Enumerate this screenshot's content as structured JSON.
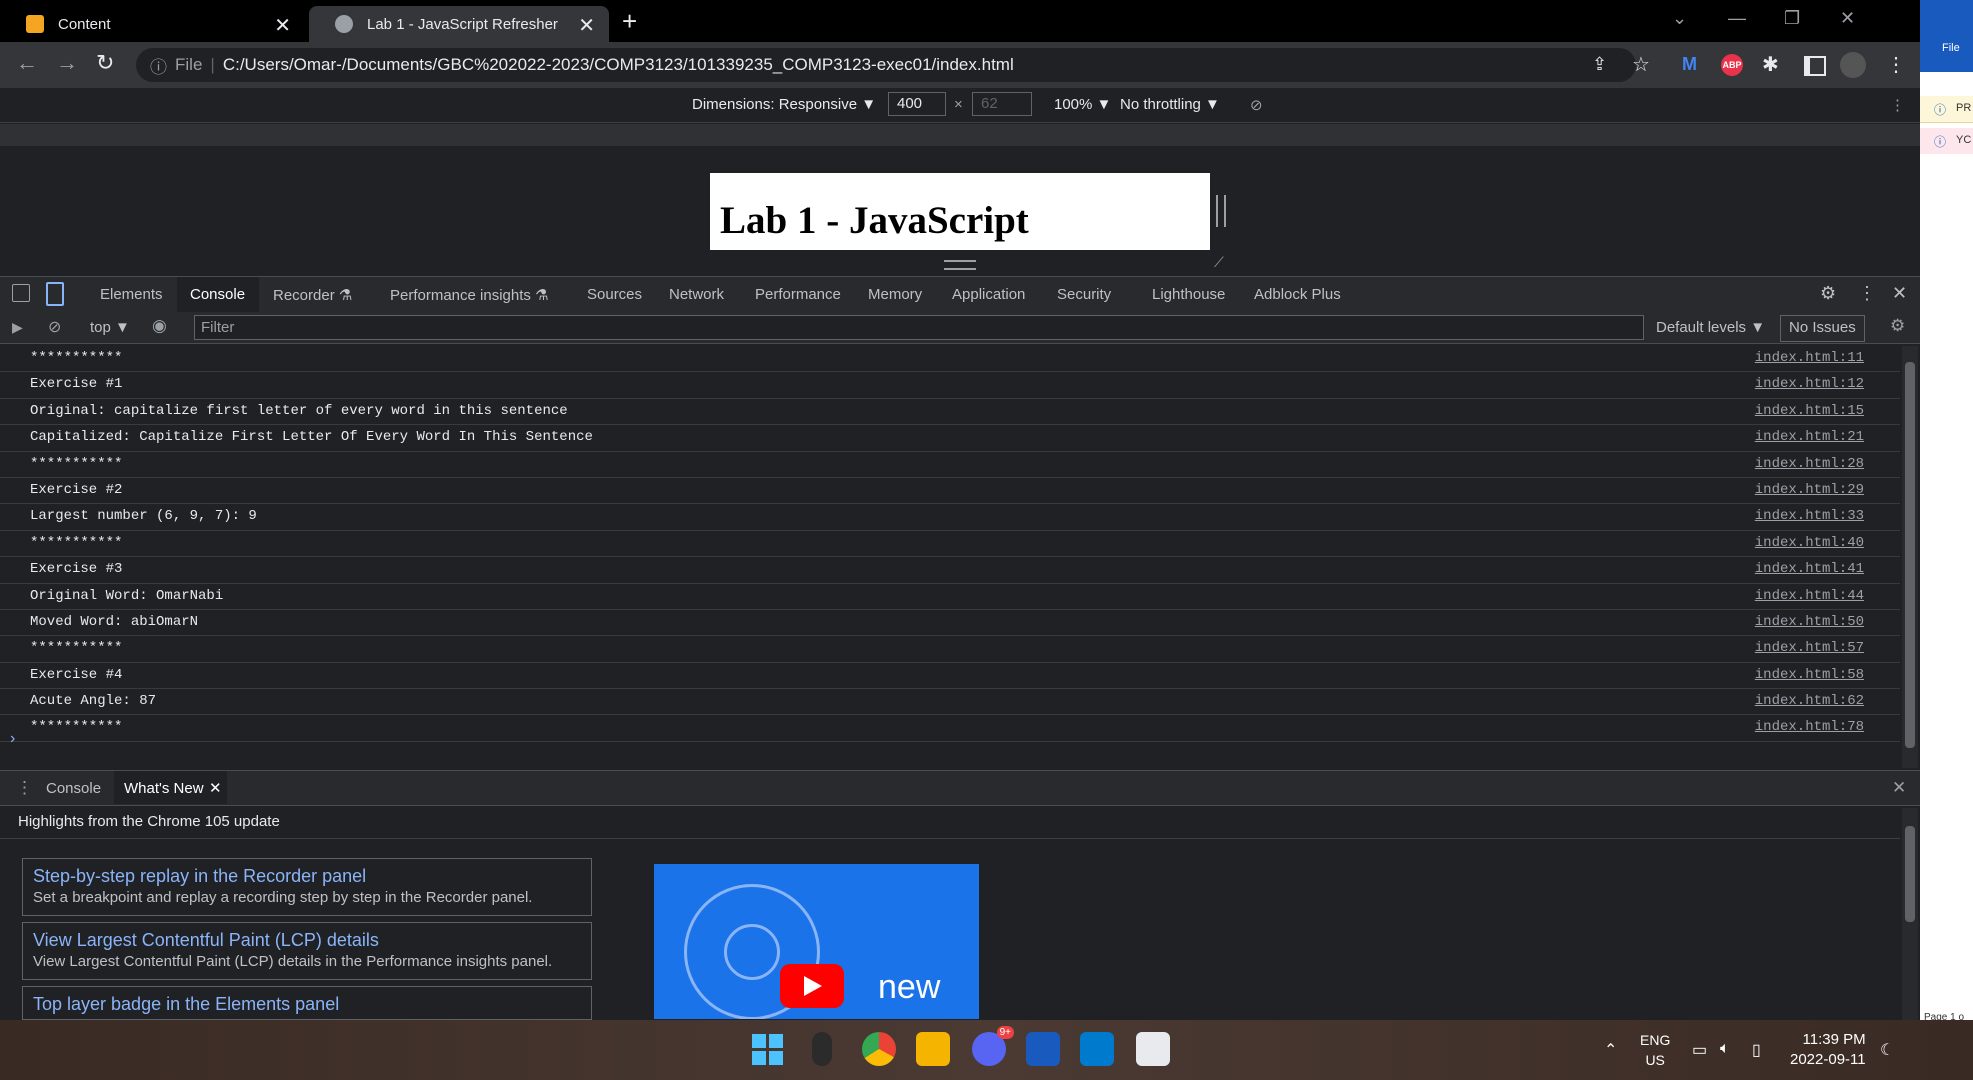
{
  "browser": {
    "tabs": [
      {
        "title": "Content"
      },
      {
        "title": "Lab 1 - JavaScript Refresher"
      }
    ],
    "url_scheme": "File",
    "url": "C:/Users/Omar-/Documents/GBC%202022-2023/COMP3123/101339235_COMP3123-exec01/index.html",
    "extensions": [
      "ABP"
    ]
  },
  "device_toolbar": {
    "dimensions_label": "Dimensions: Responsive ▼",
    "width": "400",
    "height_placeholder": "62",
    "times": "×",
    "zoom": "100% ▼",
    "throttling": "No throttling ▼"
  },
  "page": {
    "heading": "Lab 1 - JavaScript"
  },
  "devtools": {
    "tabs": [
      "Elements",
      "Console",
      "Recorder ⚗",
      "Performance insights ⚗",
      "Sources",
      "Network",
      "Performance",
      "Memory",
      "Application",
      "Security",
      "Lighthouse",
      "Adblock Plus"
    ],
    "active_tab": "Console",
    "console_toolbar": {
      "context": "top ▼",
      "filter_placeholder": "Filter",
      "levels": "Default levels ▼",
      "issues": "No Issues"
    },
    "logs": [
      {
        "msg": "***********",
        "src": "index.html:11"
      },
      {
        "msg": "Exercise #1",
        "src": "index.html:12"
      },
      {
        "msg": "Original: capitalize first letter of every word in this sentence",
        "src": "index.html:15"
      },
      {
        "msg": "Capitalized: Capitalize First Letter Of Every Word In This Sentence",
        "src": "index.html:21"
      },
      {
        "msg": "***********",
        "src": "index.html:28"
      },
      {
        "msg": "Exercise #2",
        "src": "index.html:29"
      },
      {
        "msg": "Largest number (6, 9, 7): 9",
        "src": "index.html:33"
      },
      {
        "msg": "***********",
        "src": "index.html:40"
      },
      {
        "msg": "Exercise #3",
        "src": "index.html:41"
      },
      {
        "msg": "Original Word: OmarNabi",
        "src": "index.html:44"
      },
      {
        "msg": "Moved Word: abiOmarN",
        "src": "index.html:50"
      },
      {
        "msg": "***********",
        "src": "index.html:57"
      },
      {
        "msg": "Exercise #4",
        "src": "index.html:58"
      },
      {
        "msg": "Acute Angle: 87",
        "src": "index.html:62"
      },
      {
        "msg": "***********",
        "src": "index.html:78"
      }
    ],
    "drawer": {
      "tabs": [
        "Console",
        "What's New"
      ],
      "highlights": "Highlights from the Chrome 105 update",
      "cards": [
        {
          "title": "Step-by-step replay in the Recorder panel",
          "desc": "Set a breakpoint and replay a recording step by step in the Recorder panel."
        },
        {
          "title": "View Largest Contentful Paint (LCP) details",
          "desc": "View Largest Contentful Paint (LCP) details in the Performance insights panel."
        },
        {
          "title": "Top layer badge in the Elements panel",
          "desc": ""
        }
      ],
      "video_text": "new"
    }
  },
  "side_app": {
    "file": "File",
    "items": [
      "PR",
      "YC"
    ],
    "page": "Page 1 o"
  },
  "taskbar": {
    "discord_badge": "9+",
    "lang": "ENG",
    "region": "US",
    "time": "11:39 PM",
    "date": "2022-09-11"
  }
}
